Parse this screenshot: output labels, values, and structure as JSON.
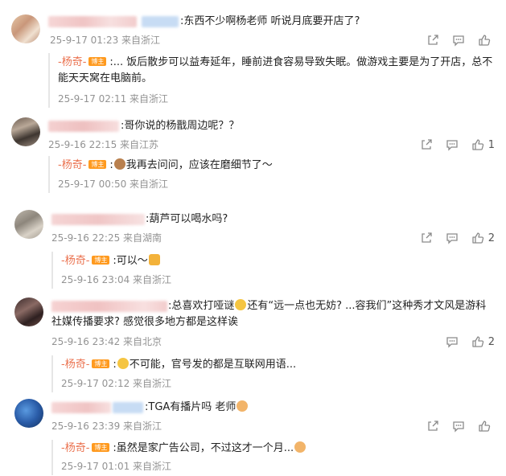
{
  "comments": [
    {
      "text": ":东西不少啊杨老师 听说月底要开店了?",
      "meta": "25-9-17 01:23 来自浙江",
      "likes": "",
      "reply": {
        "name": "-杨奇-",
        "badge": "博主",
        "text": ":... 饭后散步可以益寿延年，睡前进食容易导致失眠。做游戏主要是为了开店，总不能天天窝在电脑前。",
        "meta": "25-9-17 02:11 来自浙江"
      }
    },
    {
      "text": ":哥你说的杨戬周边呢？？",
      "meta": "25-9-16 22:15 来自江苏",
      "likes": "1",
      "reply": {
        "name": "-杨奇-",
        "badge": "博主",
        "text": "我再去问问，应该在磨细节了～",
        "meta": "25-9-17 00:50 来自浙江"
      }
    },
    {
      "text": ":葫芦可以喝水吗?",
      "meta": "25-9-16 22:25 来自湖南",
      "likes": "2",
      "reply": {
        "name": "-杨奇-",
        "badge": "博主",
        "text": ":可以～",
        "meta": "25-9-16 23:04 来自浙江"
      }
    },
    {
      "text": ":总喜欢打哑谜",
      "text_b": "还有“远一点也无妨?  ...容我们”这种秀才文风是游科社媒传播要求?  感觉很多地方都是这样诶",
      "meta": "25-9-16 23:42 来自北京",
      "likes": "2",
      "reply": {
        "name": "-杨奇-",
        "badge": "博主",
        "text": "不可能，官号发的都是互联网用语...",
        "meta": "25-9-17 02:12 来自浙江"
      }
    },
    {
      "text": ":TGA有播片吗 老师",
      "meta": "25-9-16 23:39 来自浙江",
      "likes": "",
      "reply": {
        "name": "-杨奇-",
        "badge": "博主",
        "text": ":虽然是家广告公司，不过这才一个月...",
        "meta": "25-9-17 01:01 来自浙江"
      }
    }
  ],
  "icons": {
    "share": "share-icon",
    "comment": "comment-icon",
    "like": "thumbs-up-icon"
  },
  "colors": {
    "reply_name": "#eb7350",
    "badge_bg": "#ff9a1f",
    "meta": "#939393"
  }
}
